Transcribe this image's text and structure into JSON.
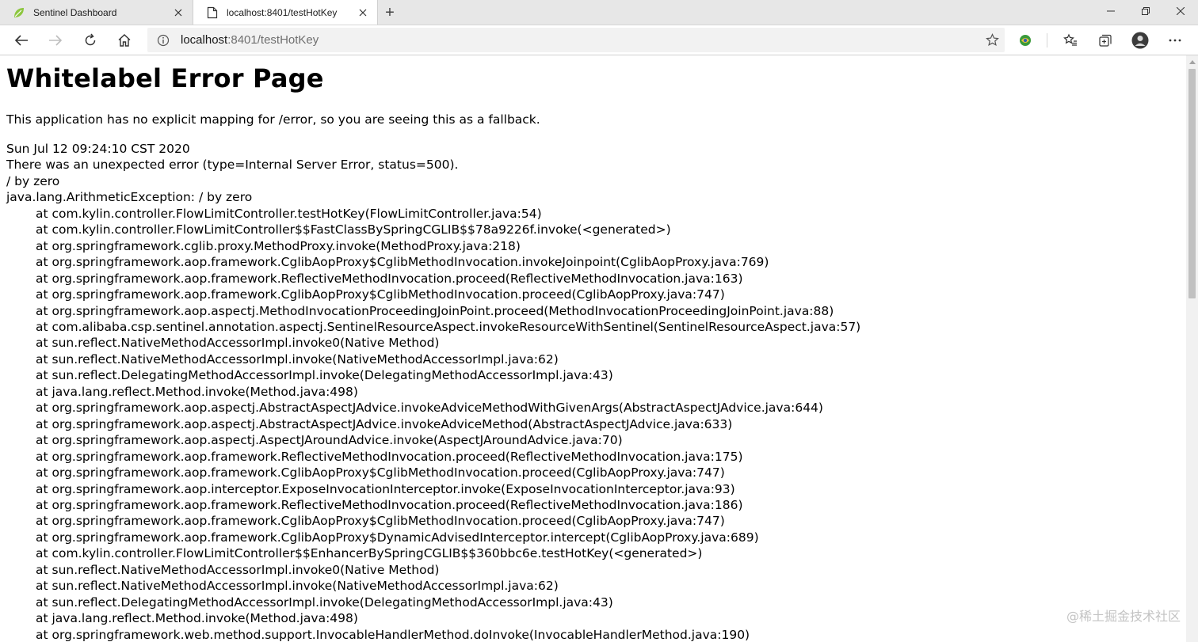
{
  "browser": {
    "tabs": [
      {
        "title": "Sentinel Dashboard",
        "active": false,
        "icon": "leaf-icon"
      },
      {
        "title": "localhost:8401/testHotKey",
        "active": true,
        "icon": "page-icon"
      }
    ],
    "new_tab_label": "+",
    "address": {
      "host": "localhost",
      "rest": ":8401/testHotKey"
    },
    "colors": {
      "tab_strip": "#e7e7e7",
      "address_bar": "#f2f2f2",
      "leaf": "#8dc63f"
    }
  },
  "page": {
    "title": "Whitelabel Error Page",
    "description": "This application has no explicit mapping for /error, so you are seeing this as a fallback.",
    "timestamp": "Sun Jul 12 09:24:10 CST 2020",
    "error_line": "There was an unexpected error (type=Internal Server Error, status=500).",
    "message": "/ by zero",
    "exception": "java.lang.ArithmeticException: / by zero",
    "frames": [
      "at com.kylin.controller.FlowLimitController.testHotKey(FlowLimitController.java:54)",
      "at com.kylin.controller.FlowLimitController$$FastClassBySpringCGLIB$$78a9226f.invoke(<generated>)",
      "at org.springframework.cglib.proxy.MethodProxy.invoke(MethodProxy.java:218)",
      "at org.springframework.aop.framework.CglibAopProxy$CglibMethodInvocation.invokeJoinpoint(CglibAopProxy.java:769)",
      "at org.springframework.aop.framework.ReflectiveMethodInvocation.proceed(ReflectiveMethodInvocation.java:163)",
      "at org.springframework.aop.framework.CglibAopProxy$CglibMethodInvocation.proceed(CglibAopProxy.java:747)",
      "at org.springframework.aop.aspectj.MethodInvocationProceedingJoinPoint.proceed(MethodInvocationProceedingJoinPoint.java:88)",
      "at com.alibaba.csp.sentinel.annotation.aspectj.SentinelResourceAspect.invokeResourceWithSentinel(SentinelResourceAspect.java:57)",
      "at sun.reflect.NativeMethodAccessorImpl.invoke0(Native Method)",
      "at sun.reflect.NativeMethodAccessorImpl.invoke(NativeMethodAccessorImpl.java:62)",
      "at sun.reflect.DelegatingMethodAccessorImpl.invoke(DelegatingMethodAccessorImpl.java:43)",
      "at java.lang.reflect.Method.invoke(Method.java:498)",
      "at org.springframework.aop.aspectj.AbstractAspectJAdvice.invokeAdviceMethodWithGivenArgs(AbstractAspectJAdvice.java:644)",
      "at org.springframework.aop.aspectj.AbstractAspectJAdvice.invokeAdviceMethod(AbstractAspectJAdvice.java:633)",
      "at org.springframework.aop.aspectj.AspectJAroundAdvice.invoke(AspectJAroundAdvice.java:70)",
      "at org.springframework.aop.framework.ReflectiveMethodInvocation.proceed(ReflectiveMethodInvocation.java:175)",
      "at org.springframework.aop.framework.CglibAopProxy$CglibMethodInvocation.proceed(CglibAopProxy.java:747)",
      "at org.springframework.aop.interceptor.ExposeInvocationInterceptor.invoke(ExposeInvocationInterceptor.java:93)",
      "at org.springframework.aop.framework.ReflectiveMethodInvocation.proceed(ReflectiveMethodInvocation.java:186)",
      "at org.springframework.aop.framework.CglibAopProxy$CglibMethodInvocation.proceed(CglibAopProxy.java:747)",
      "at org.springframework.aop.framework.CglibAopProxy$DynamicAdvisedInterceptor.intercept(CglibAopProxy.java:689)",
      "at com.kylin.controller.FlowLimitController$$EnhancerBySpringCGLIB$$360bbc6e.testHotKey(<generated>)",
      "at sun.reflect.NativeMethodAccessorImpl.invoke0(Native Method)",
      "at sun.reflect.NativeMethodAccessorImpl.invoke(NativeMethodAccessorImpl.java:62)",
      "at sun.reflect.DelegatingMethodAccessorImpl.invoke(DelegatingMethodAccessorImpl.java:43)",
      "at java.lang.reflect.Method.invoke(Method.java:498)",
      "at org.springframework.web.method.support.InvocableHandlerMethod.doInvoke(InvocableHandlerMethod.java:190)"
    ]
  },
  "watermark": "@稀土掘金技术社区"
}
